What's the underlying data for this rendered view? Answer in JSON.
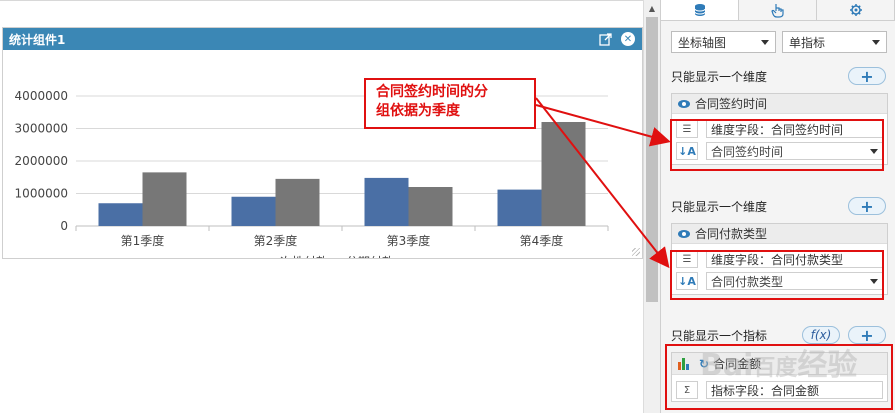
{
  "widget": {
    "title": "统计组件1"
  },
  "chart_data": {
    "type": "bar",
    "categories": [
      "第1季度",
      "第2季度",
      "第3季度",
      "第4季度"
    ],
    "series": [
      {
        "name": "一次性付款",
        "color": "#4a6fa5",
        "values": [
          700000,
          900000,
          1480000,
          1120000
        ]
      },
      {
        "name": "分期付款",
        "color": "#777777",
        "values": [
          1650000,
          1450000,
          1200000,
          3200000
        ]
      }
    ],
    "ylim": [
      0,
      4000000
    ],
    "yticks": [
      "0",
      "1000000",
      "2000000",
      "3000000",
      "4000000"
    ],
    "legend_position": "bottom"
  },
  "annotation": {
    "callout_text_line1": "合同签约时间的分",
    "callout_text_line2": "组依据为季度"
  },
  "panel": {
    "tabs": [
      {
        "icon": "database-icon"
      },
      {
        "icon": "pointer-hand-icon"
      },
      {
        "icon": "gear-icon"
      }
    ],
    "chart_type_select": "坐标轴图",
    "indicator_select": "单指标",
    "section1": {
      "label": "只能显示一个维度",
      "card_title": "合同签约时间",
      "field_label": "维度字段：合同签约时间",
      "sort_value": "合同签约时间"
    },
    "section2": {
      "label": "只能显示一个维度",
      "card_title": "合同付款类型",
      "field_label": "维度字段：合同付款类型",
      "sort_value": "合同付款类型"
    },
    "section3": {
      "label": "只能显示一个指标",
      "fx_label": "f(x)",
      "card_title": "合同金额",
      "field_label": "指标字段：合同金额"
    },
    "plus": "+"
  },
  "watermark": "Bai百度经验"
}
